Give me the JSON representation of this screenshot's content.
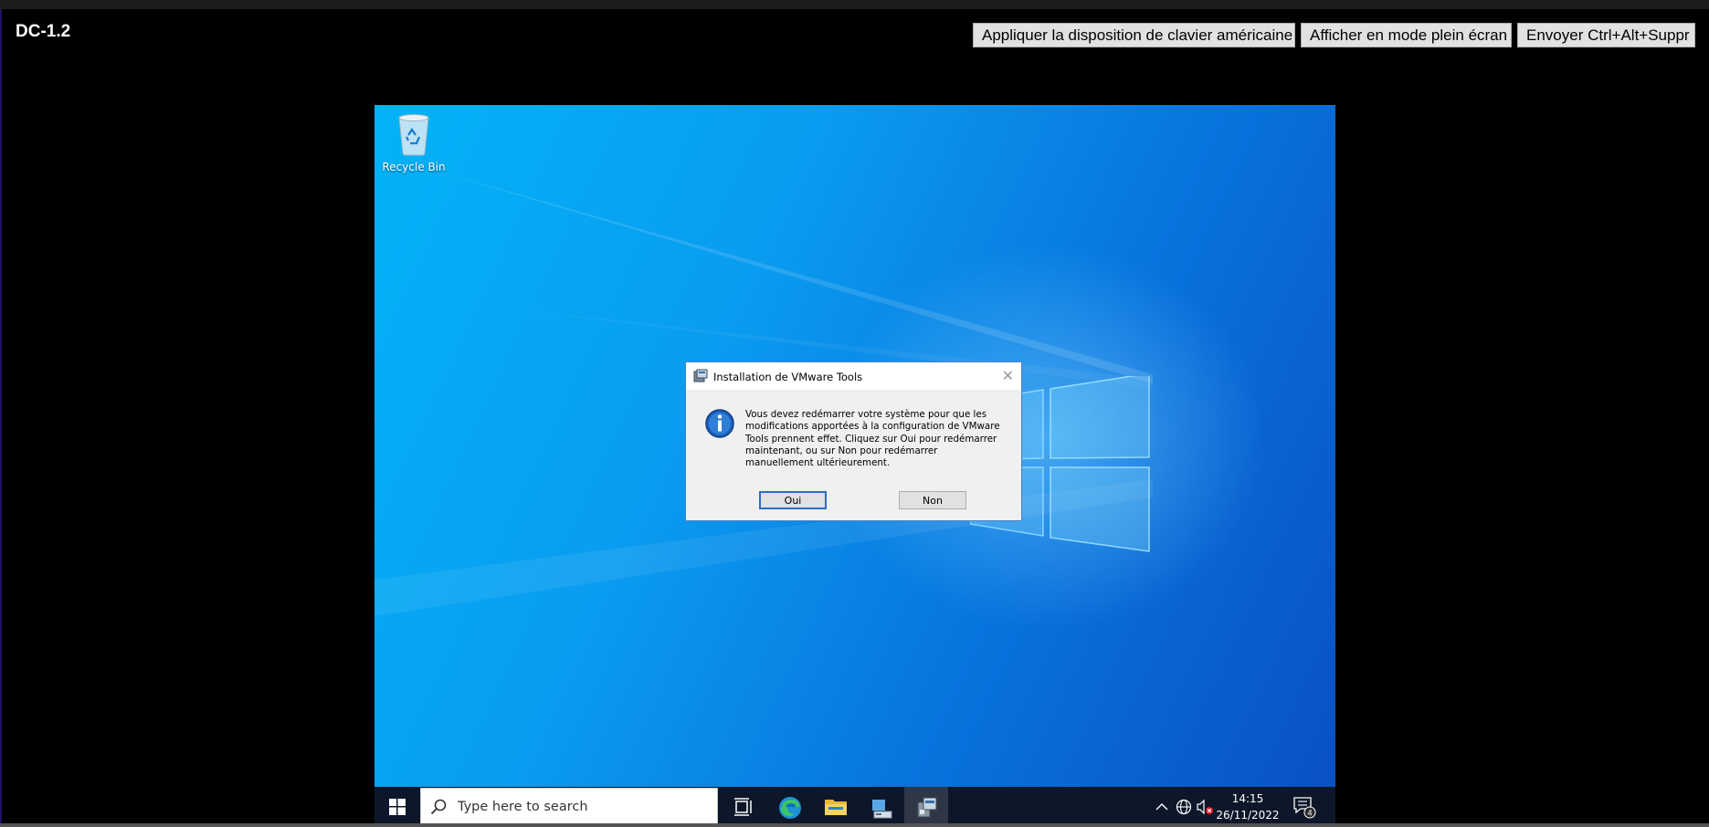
{
  "console": {
    "title": "DC-1.2",
    "buttons": {
      "us_keyboard": "Appliquer la disposition de clavier américaine",
      "fullscreen": "Afficher en mode plein écran",
      "ctrl_alt_del": "Envoyer Ctrl+Alt+Suppr"
    }
  },
  "desktop": {
    "icons": [
      {
        "label": "Recycle Bin",
        "icon": "recycle-bin-icon"
      }
    ]
  },
  "dialog": {
    "title": "Installation de VMware Tools",
    "message": "Vous devez redémarrer votre système pour que les modifications apportées à la configuration de VMware Tools prennent effet. Cliquez sur Oui pour redémarrer maintenant, ou sur Non pour redémarrer manuellement ultérieurement.",
    "buttons": {
      "yes": "Oui",
      "no": "Non"
    },
    "icon": "info-icon"
  },
  "taskbar": {
    "search_placeholder": "Type here to search",
    "pinned_apps": [
      "task-view-icon",
      "edge-icon",
      "file-explorer-icon",
      "server-manager-icon",
      "vmware-tools-setup-icon"
    ],
    "active_app": "vmware-tools-setup-icon",
    "tray": {
      "time": "14:15",
      "date": "26/11/2022",
      "notification_count": "4"
    }
  },
  "colors": {
    "desktop_blue": "#0a9cf0",
    "taskbar": "#0d1729",
    "dialog_border": "#4a7fc1",
    "default_button_border": "#2d6cc6"
  }
}
